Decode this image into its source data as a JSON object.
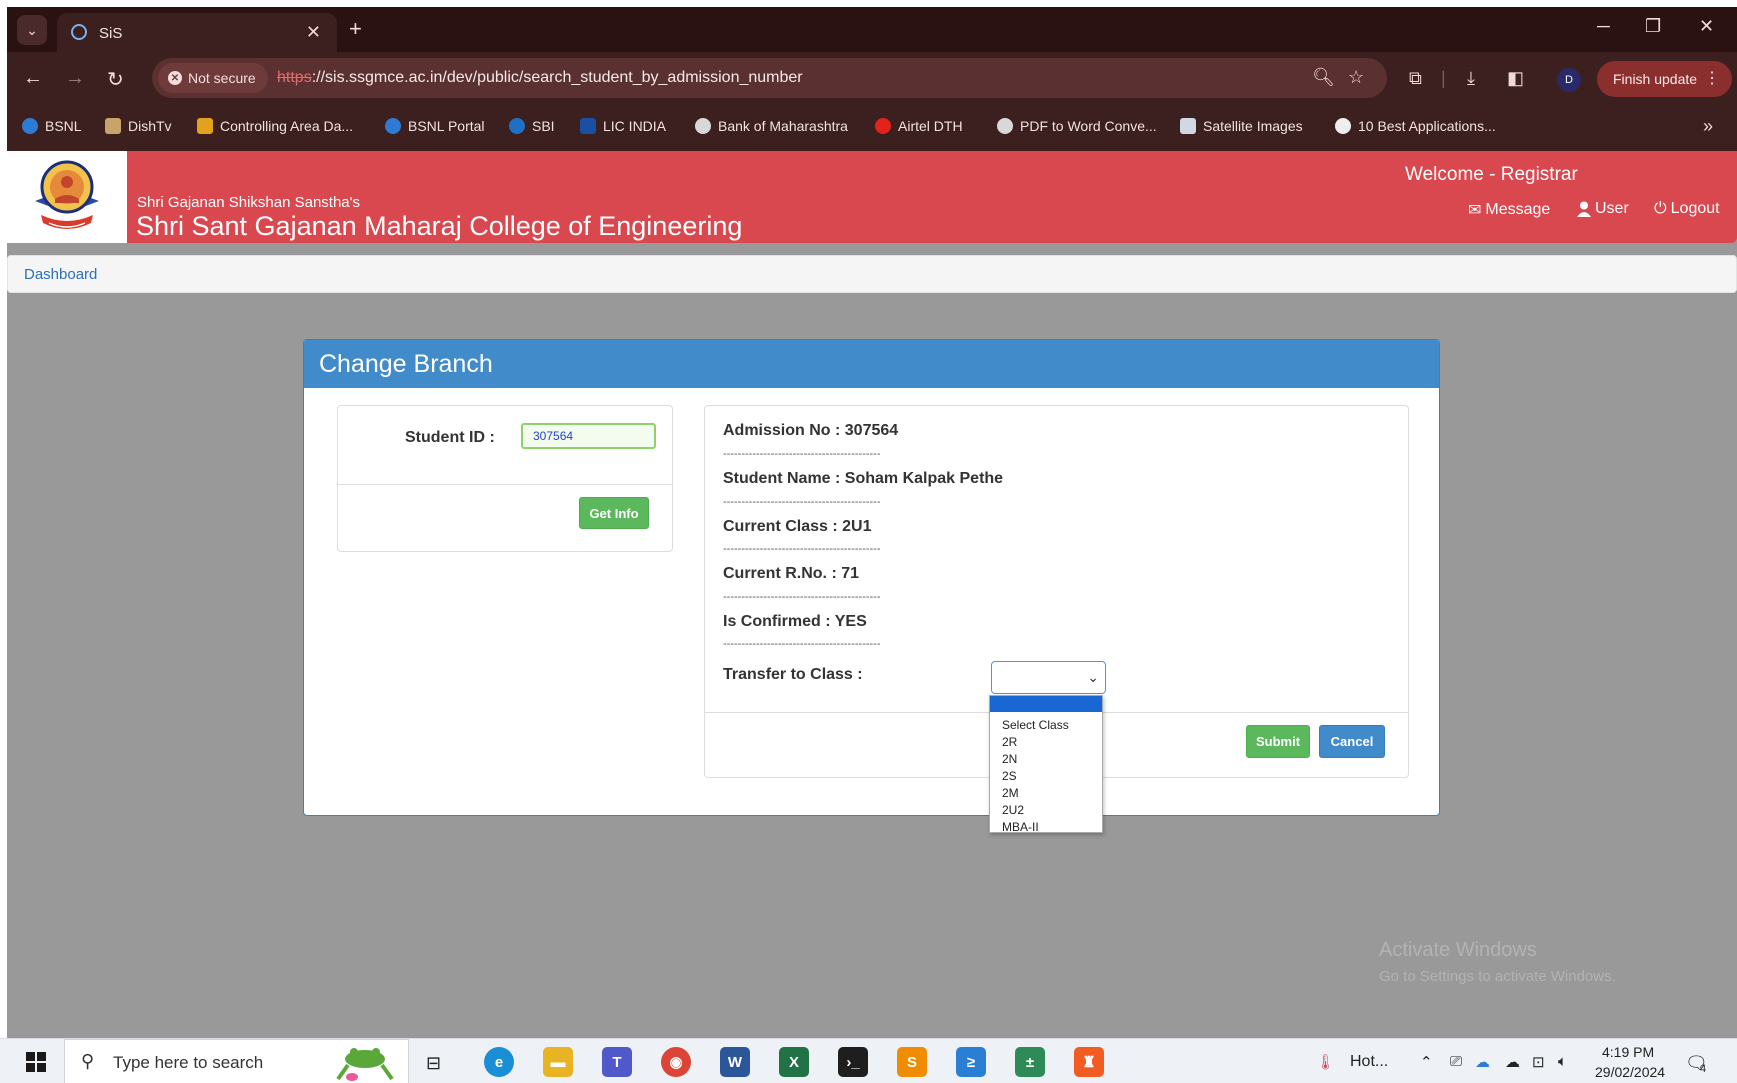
{
  "browser": {
    "tab_title": "SiS",
    "tab_close": "✕",
    "new_tab": "+",
    "not_secure": "Not secure",
    "url_scheme": "https",
    "url_rest": "://sis.ssgmce.ac.in/dev/public/search_student_by_admission_number",
    "profile_initial": "D",
    "finish_update": "Finish update",
    "bookmarks": [
      "BSNL",
      "DishTv",
      "Controlling Area Da...",
      "BSNL Portal",
      "SBI",
      "LIC INDIA",
      "Bank of Maharashtra",
      "Airtel DTH",
      "PDF to Word Conve...",
      "Satellite Images",
      "10 Best Applications..."
    ],
    "bookmarks_more": "»"
  },
  "header": {
    "subtitle": "Shri Gajanan Shikshan Sanstha's",
    "title": "Shri Sant Gajanan Maharaj College of Engineering",
    "welcome": "Welcome - Registrar",
    "message_link": "Message",
    "user_link": "User",
    "logout_link": "Logout"
  },
  "breadcrumb": {
    "dashboard": "Dashboard"
  },
  "panel": {
    "title": "Change Branch",
    "student_id_label": "Student ID :",
    "student_id_value": "307564",
    "get_info_button": "Get Info",
    "info": {
      "admission_no": "Admission No : 307564",
      "student_name": "Student Name : Soham Kalpak Pethe",
      "current_class": "Current Class : 2U1",
      "current_rno": "Current R.No. : 71",
      "is_confirmed": "Is Confirmed : YES",
      "separator": "-------------------------------------------"
    },
    "transfer_label": "Transfer to Class :",
    "transfer_selected": "",
    "transfer_options": [
      "",
      "Select Class",
      "2R",
      "2N",
      "2S",
      "2M",
      "2U2",
      "MBA-II"
    ],
    "submit_button": "Submit",
    "cancel_button": "Cancel"
  },
  "watermark": {
    "line1": "Activate Windows",
    "line2": "Go to Settings to activate Windows."
  },
  "taskbar": {
    "search_placeholder": "Type here to search",
    "weather": "Hot...",
    "time": "4:19 PM",
    "date": "29/02/2024",
    "notification_count": "4"
  },
  "colors": {
    "header_red": "#d9474f",
    "panel_blue": "#428bca",
    "button_green": "#5cb85c",
    "page_gray": "#999999"
  }
}
